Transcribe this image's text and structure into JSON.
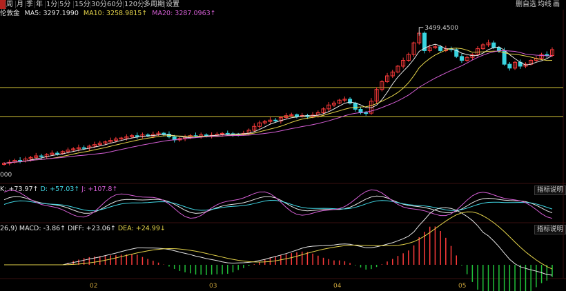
{
  "toolbar": {
    "active_tab": "日",
    "periods": [
      "周",
      "月",
      "季",
      "年",
      "1分",
      "5分",
      "15分",
      "30分",
      "60分",
      "120分",
      "多周期",
      "设置"
    ],
    "right_items": [
      "删自选",
      "均线",
      "画"
    ]
  },
  "legend": {
    "name": "伦敦金",
    "ma5": "MA5: 3297.1990",
    "ma10": "MA10: 3258.9815↑",
    "ma20": "MA20: 3287.0963↑"
  },
  "kdj_legend": {
    "k": "K: +73.97↑",
    "d": "D: +57.03↑",
    "j": "J: +107.8↑"
  },
  "macd_legend": {
    "params": "26,9)",
    "macd": "MACD: -3.86↑",
    "diff": "DIFF: +23.06↑",
    "dea": "DEA: +24.99↓"
  },
  "help_label": "指标说明",
  "price_annotation": "3499.4500",
  "low_label": "000",
  "x_axis": [
    "02",
    "03",
    "04",
    "05"
  ],
  "colors": {
    "up": "#ff3b3b",
    "down": "#39d4e0",
    "ma5": "#e6e6e6",
    "ma10": "#e5d44a",
    "ma20": "#d65fd6",
    "hline": "#d8c838"
  },
  "chart_data": {
    "type": "candlestick",
    "series_name": "伦敦金",
    "x_labels": [
      "02",
      "03",
      "04",
      "05"
    ],
    "highest_labeled": 3499.45,
    "closes": [
      2800,
      2805,
      2815,
      2812,
      2822,
      2830,
      2838,
      2835,
      2845,
      2852,
      2850,
      2860,
      2868,
      2874,
      2880,
      2878,
      2888,
      2896,
      2904,
      2910,
      2918,
      2925,
      2930,
      2936,
      2942,
      2938,
      2946,
      2940,
      2948,
      2955,
      2950,
      2936,
      2920,
      2928,
      2934,
      2942,
      2938,
      2946,
      2940,
      2944,
      2950,
      2954,
      2952,
      2950,
      2948,
      2954,
      2970,
      2990,
      3008,
      3015,
      3022,
      3018,
      3035,
      3045,
      3050,
      3042,
      3046,
      3040,
      3048,
      3060,
      3080,
      3100,
      3110,
      3125,
      3130,
      3110,
      3078,
      3060,
      3058,
      3120,
      3180,
      3220,
      3250,
      3270,
      3300,
      3330,
      3360,
      3420,
      3470,
      3380,
      3395,
      3400,
      3380,
      3390,
      3385,
      3350,
      3330,
      3345,
      3360,
      3390,
      3410,
      3420,
      3395,
      3380,
      3310,
      3290,
      3320,
      3300,
      3310,
      3330,
      3340,
      3360,
      3355,
      3385
    ],
    "indicators": {
      "ma5": 3297.199,
      "ma10": 3258.9815,
      "ma20": 3287.0963,
      "k": 73.97,
      "d": 57.03,
      "j": 107.8,
      "macd": -3.86,
      "diff": 23.06,
      "dea": 24.99
    }
  }
}
